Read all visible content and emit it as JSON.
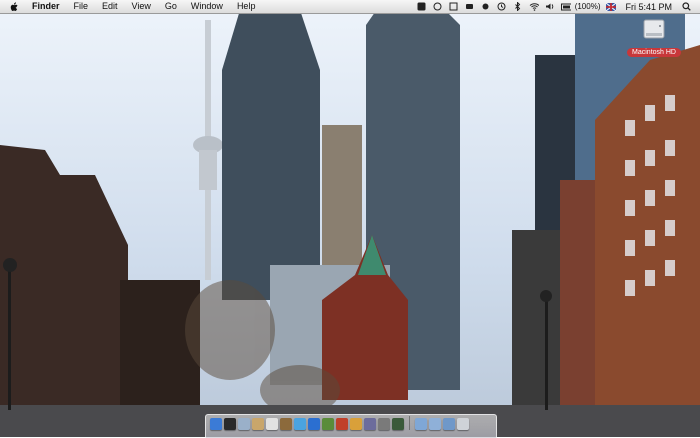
{
  "menubar": {
    "app_name": "Finder",
    "menus": [
      "File",
      "Edit",
      "View",
      "Go",
      "Window",
      "Help"
    ],
    "battery_percent": "(100%)",
    "clock": "Fri 5:41 PM"
  },
  "desktop": {
    "drive_label": "Macintosh HD"
  },
  "dock": {
    "apps": [
      {
        "icon": "finder-icon",
        "color": "#3b7bd6"
      },
      {
        "icon": "dashboard-icon",
        "color": "#2a2a2a"
      },
      {
        "icon": "mail-icon",
        "color": "#9ab0c9"
      },
      {
        "icon": "preview-icon",
        "color": "#c9a66b"
      },
      {
        "icon": "ical-icon",
        "color": "#e2e2e2"
      },
      {
        "icon": "address-book-icon",
        "color": "#8c6a3c"
      },
      {
        "icon": "safari-icon",
        "color": "#4aa3e0"
      },
      {
        "icon": "itunes-icon",
        "color": "#2b6fd1"
      },
      {
        "icon": "iphoto-icon",
        "color": "#5a8c3a"
      },
      {
        "icon": "imovie-icon",
        "color": "#c0402a"
      },
      {
        "icon": "garageband-icon",
        "color": "#d9a03a"
      },
      {
        "icon": "xcode-icon",
        "color": "#6c6c9c"
      },
      {
        "icon": "system-preferences-icon",
        "color": "#7a7a7a"
      },
      {
        "icon": "time-machine-icon",
        "color": "#3a5a3a"
      }
    ],
    "docs": [
      {
        "icon": "applications-folder-icon",
        "color": "#7fa7d6"
      },
      {
        "icon": "documents-folder-icon",
        "color": "#8fb0d8"
      },
      {
        "icon": "downloads-folder-icon",
        "color": "#6f98c9"
      },
      {
        "icon": "trash-icon",
        "color": "#cfd3d8"
      }
    ]
  }
}
